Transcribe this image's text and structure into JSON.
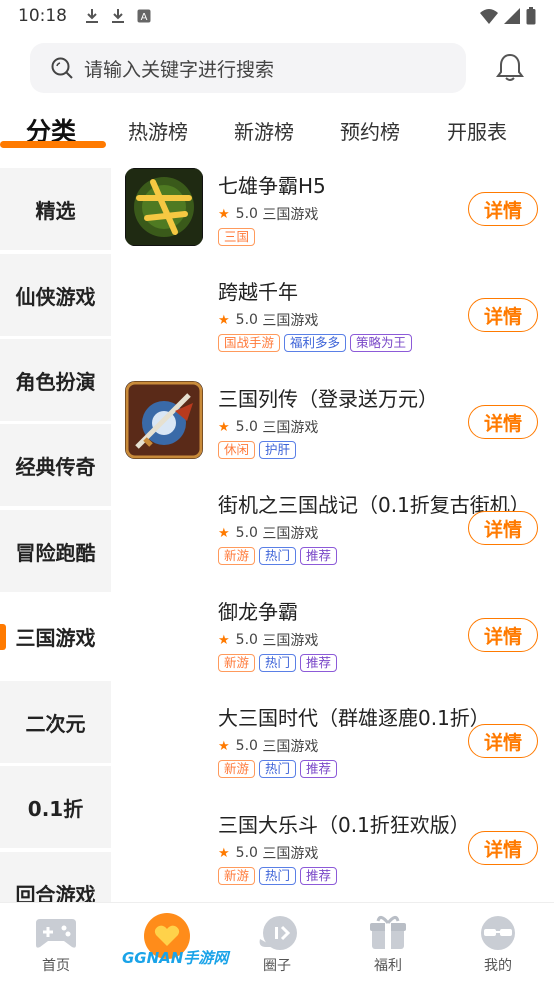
{
  "status_bar": {
    "time": "10:18"
  },
  "search": {
    "placeholder": "请输入关键字进行搜索"
  },
  "tabs": [
    {
      "label": "分类",
      "active": true
    },
    {
      "label": "热游榜",
      "active": false
    },
    {
      "label": "新游榜",
      "active": false
    },
    {
      "label": "预约榜",
      "active": false
    },
    {
      "label": "开服表",
      "active": false
    }
  ],
  "sidebar": {
    "items": [
      {
        "label": "精选"
      },
      {
        "label": "仙侠游戏"
      },
      {
        "label": "角色扮演"
      },
      {
        "label": "经典传奇"
      },
      {
        "label": "冒险跑酷"
      },
      {
        "label": "三国游戏",
        "active": true
      },
      {
        "label": "二次元"
      },
      {
        "label": "0.1折"
      },
      {
        "label": "回合游戏"
      }
    ]
  },
  "games": [
    {
      "title": "七雄争霸H5",
      "rating": "5.0",
      "genre": "三国游戏",
      "icon": "qixiong-icon",
      "detail_label": "详情",
      "tags": [
        {
          "text": "三国",
          "color": "orange"
        }
      ]
    },
    {
      "title": "跨越千年",
      "rating": "5.0",
      "genre": "三国游戏",
      "icon": "",
      "detail_label": "详情",
      "tags": [
        {
          "text": "国战手游",
          "color": "orange"
        },
        {
          "text": "福利多多",
          "color": "blue"
        },
        {
          "text": "策略为王",
          "color": "purple"
        }
      ]
    },
    {
      "title": "三国列传（登录送万元）",
      "rating": "5.0",
      "genre": "三国游戏",
      "icon": "sword-warrior-icon",
      "detail_label": "详情",
      "tags": [
        {
          "text": "休闲",
          "color": "orange"
        },
        {
          "text": "护肝",
          "color": "blue"
        }
      ]
    },
    {
      "title": "街机之三国战记（0.1折复古街机）",
      "rating": "5.0",
      "genre": "三国游戏",
      "icon": "",
      "detail_label": "详情",
      "tags": [
        {
          "text": "新游",
          "color": "orange"
        },
        {
          "text": "热门",
          "color": "blue"
        },
        {
          "text": "推荐",
          "color": "purple"
        }
      ]
    },
    {
      "title": "御龙争霸",
      "rating": "5.0",
      "genre": "三国游戏",
      "icon": "",
      "detail_label": "详情",
      "tags": [
        {
          "text": "新游",
          "color": "orange"
        },
        {
          "text": "热门",
          "color": "blue"
        },
        {
          "text": "推荐",
          "color": "purple"
        }
      ]
    },
    {
      "title": "大三国时代（群雄逐鹿0.1折）",
      "rating": "5.0",
      "genre": "三国游戏",
      "icon": "",
      "detail_label": "详情",
      "tags": [
        {
          "text": "新游",
          "color": "orange"
        },
        {
          "text": "热门",
          "color": "blue"
        },
        {
          "text": "推荐",
          "color": "purple"
        }
      ]
    },
    {
      "title": "三国大乐斗（0.1折狂欢版）",
      "rating": "5.0",
      "genre": "三国游戏",
      "icon": "",
      "detail_label": "详情",
      "tags": [
        {
          "text": "新游",
          "color": "orange"
        },
        {
          "text": "热门",
          "color": "blue"
        },
        {
          "text": "推荐",
          "color": "purple"
        }
      ]
    }
  ],
  "bottom_nav": [
    {
      "label": "首页",
      "icon": "gamepad-icon"
    },
    {
      "label": "",
      "icon": "heart-icon"
    },
    {
      "label": "圈子",
      "icon": "chat-icon"
    },
    {
      "label": "福利",
      "icon": "gift-icon"
    },
    {
      "label": "我的",
      "icon": "profile-icon"
    }
  ],
  "watermark": "GGNAN手游网",
  "colors": {
    "accent": "#ff7a00",
    "tag_orange": "#ff7a3a",
    "tag_blue": "#3d63d8",
    "tag_purple": "#7a48c8"
  }
}
